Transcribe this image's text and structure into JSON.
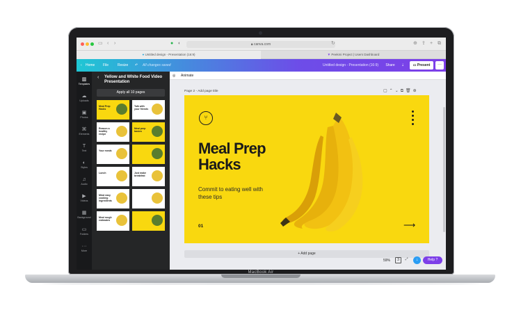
{
  "laptop": {
    "brand": "MacBook Air"
  },
  "browser": {
    "url": "canva.com",
    "tabs": [
      "Untitled design - Presentation (16:9)",
      "Peekmi Project | Users Dashboard"
    ]
  },
  "topbar": {
    "home": "Home",
    "file": "File",
    "resize": "Resize",
    "saved": "All changes saved",
    "design_title": "Untitled design - Presentation (16:9)",
    "share": "Share",
    "present": "Present",
    "more": "···"
  },
  "rail": [
    {
      "label": "Templates",
      "icon": "templates-icon",
      "glyph": "▥"
    },
    {
      "label": "Uploads",
      "icon": "upload-icon",
      "glyph": "☁"
    },
    {
      "label": "Photos",
      "icon": "photos-icon",
      "glyph": "▣"
    },
    {
      "label": "Elements",
      "icon": "elements-icon",
      "glyph": "⌘"
    },
    {
      "label": "Text",
      "icon": "text-icon",
      "glyph": "T"
    },
    {
      "label": "Styles",
      "icon": "styles-icon",
      "glyph": "◐"
    },
    {
      "label": "Audio",
      "icon": "audio-icon",
      "glyph": "♫"
    },
    {
      "label": "Videos",
      "icon": "videos-icon",
      "glyph": "▶"
    },
    {
      "label": "Background",
      "icon": "background-icon",
      "glyph": "▦"
    },
    {
      "label": "Folders",
      "icon": "folder-icon",
      "glyph": "▭"
    },
    {
      "label": "More",
      "icon": "more-icon",
      "glyph": "···"
    }
  ],
  "panel": {
    "title": "Yellow and White Food Video Presentation",
    "apply": "Apply all 10 pages",
    "thumbs": [
      {
        "title": "Meal Prep Hacks",
        "bg": "#f9d80f"
      },
      {
        "title": "Talk with your friends",
        "bg": "#ffffff"
      },
      {
        "title": "Reason a healthy recipe",
        "bg": "#ffffff"
      },
      {
        "title": "Meal prep basics",
        "bg": "#f9d80f"
      },
      {
        "title": "Your meals",
        "bg": "#ffffff"
      },
      {
        "title": "",
        "bg": "#f9d80f"
      },
      {
        "title": "Lunch",
        "bg": "#ffffff"
      },
      {
        "title": "Just make breakfast",
        "bg": "#ffffff"
      },
      {
        "title": "Mind easy cooking ingredients",
        "bg": "#ffffff"
      },
      {
        "title": "",
        "bg": "#ffffff"
      },
      {
        "title": "Meal rough estimates",
        "bg": "#ffffff"
      },
      {
        "title": "",
        "bg": "#f9d80f"
      }
    ]
  },
  "canvas": {
    "animate": "Animate",
    "page_label": "Page 2 - Add page title",
    "headline_1": "Meal Prep",
    "headline_2": "Hacks",
    "sub": "Commit to eating well with these tips",
    "number": "01",
    "add_page": "+ Add page",
    "zoom": "59%",
    "help": "Help ?"
  },
  "colors": {
    "slide_yellow": "#f9d80f",
    "accent_purple": "#7d3fe8",
    "accent_teal": "#1fc7d4",
    "download_blue": "#2a9df4"
  }
}
